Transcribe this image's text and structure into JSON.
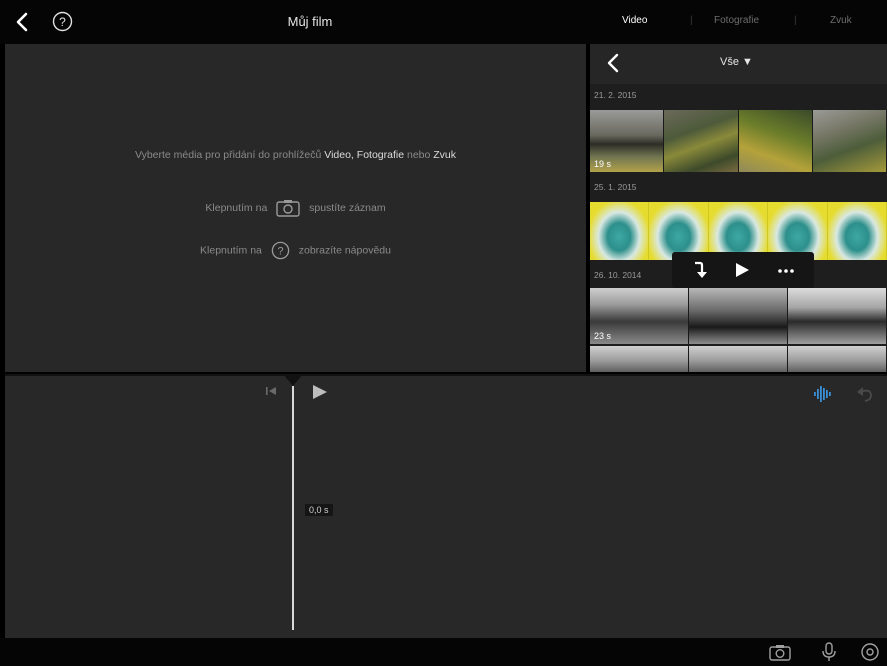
{
  "header": {
    "title": "Můj film",
    "tabs": [
      {
        "label": "Video",
        "active": true
      },
      {
        "label": "Fotografie",
        "active": false
      },
      {
        "label": "Zvuk",
        "active": false
      }
    ],
    "separator": "|"
  },
  "viewer": {
    "instruction_prefix": "Vyberte média pro přidání do prohlížečů",
    "instruction_video": "Video,",
    "instruction_photos": "Fotografie",
    "instruction_or": "nebo",
    "instruction_audio": "Zvuk",
    "record_prefix": "Klepnutím na",
    "record_suffix": "spustíte záznam",
    "help_prefix": "Klepnutím na",
    "help_suffix": "zobrazíte nápovědu"
  },
  "browser": {
    "filter_label": "Vše ▼",
    "groups": [
      {
        "date": "21. 2. 2015",
        "duration": "19 s"
      },
      {
        "date": "25. 1. 2015",
        "duration": ""
      },
      {
        "date": "26. 10. 2014",
        "duration": "23 s"
      }
    ]
  },
  "timeline": {
    "time_label": "0,0 s"
  },
  "colors": {
    "accent": "#3a8fd6",
    "background": "#282828",
    "bar": "#050505"
  },
  "icons": {
    "back": "chevron-left-icon",
    "help": "help-circle-icon",
    "camera": "camera-icon",
    "microphone": "microphone-icon",
    "settings": "settings-icon",
    "audio_waveform": "waveform-icon",
    "undo": "undo-icon"
  }
}
